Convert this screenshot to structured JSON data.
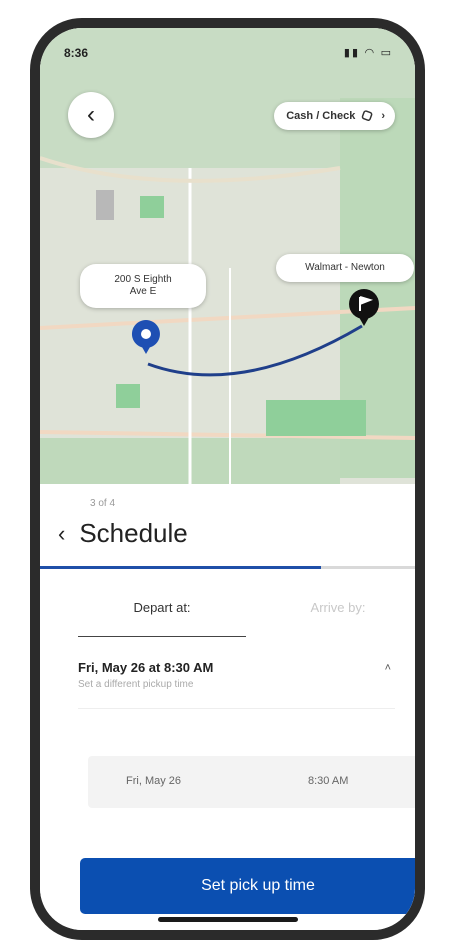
{
  "status_bar": {
    "time": "8:36",
    "indicators": "▮▮ ◠ ▭"
  },
  "map": {
    "back_icon": "‹",
    "payment_label": "Cash / Check",
    "payment_arrow": "›",
    "origin_label_line1": "200 S Eighth",
    "origin_label_line2": "Ave E",
    "destination_label": "Walmart - Newton"
  },
  "schedule": {
    "step": "3 of 4",
    "title": "Schedule",
    "back_icon": "‹",
    "progress_fraction": 0.75,
    "tabs": [
      {
        "label": "Depart at:"
      },
      {
        "label": "Arrive by:"
      }
    ],
    "selected_time": "Fri, May 26 at 8:30 AM",
    "selected_sub": "Set a different pickup time",
    "collapse_icon": "˄",
    "picker_date": "Fri, May 26",
    "picker_time": "8:30 AM",
    "cta_label": "Set pick up time"
  },
  "colors": {
    "accent": "#0b4fb1",
    "route": "#1f3f8a",
    "map_green": "#8fcf9a"
  }
}
